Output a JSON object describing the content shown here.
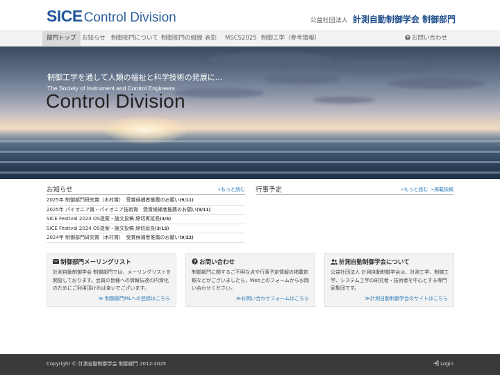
{
  "header": {
    "logo_bold": "SICE",
    "logo_rest": "Control Division",
    "org_sub": "公益社団法人",
    "org_main": "計測自動制御学会 制御部門"
  },
  "nav": {
    "items": [
      "部門トップ",
      "お知らせ",
      "制御部門について",
      "制御部門の組織",
      "表彰",
      "MSCS2025",
      "制御工学（参考情報）"
    ],
    "contact_icon": "question-circle-icon",
    "contact": "お問い合わせ"
  },
  "hero": {
    "tagline": "制御工学を通して人類の福祉と科学技術の発展に…",
    "society": "The Society of Instrument and Control Engineers",
    "title": "Control Division"
  },
  "news": {
    "title": "お知らせ",
    "more": "»もっと読む",
    "items": [
      {
        "text": "2025年 制御部門研究賞（木村賞）　受賞候補者推薦のお願い",
        "date": "(9/11)"
      },
      {
        "text": "2025年 パイオニア賞・パイオニア技術賞　受賞候補者推薦のお願い",
        "date": "(9/11)"
      },
      {
        "text": "SICE Festival 2024 OS提案・論文投稿 締切再延長",
        "date": "(4/5)"
      },
      {
        "text": "SICE Festival 2024 OS提案・論文投稿 締切延長",
        "date": "(3/15)"
      },
      {
        "text": "2024年 制御部門研究賞（木村賞）　受賞候補者推薦のお願い",
        "date": "(9/22)"
      }
    ]
  },
  "events": {
    "title": "行事予定",
    "more": "»もっと読む",
    "request": "»掲載依頼"
  },
  "cards": [
    {
      "icon": "envelope-icon",
      "title": "制御部門メーリングリスト",
      "text": "計測自動制御学会 制御部門では、メーリングリストを開設しております。会員の皆様への情報伝達の円滑化のためにご利用頂ければ幸いでございます。",
      "link": "≫ 制御部門MLへの登録はこちら"
    },
    {
      "icon": "question-circle-icon",
      "title": "お問い合わせ",
      "text": "制御部門に関するご不明な点や行事予定情報の掲載依頼などがございましたら，Web上のフォームからお問い合わせください。",
      "link": "≫お問い合わせフォームはこちら"
    },
    {
      "icon": "users-icon",
      "title": "計測自動制御学会について",
      "text": "公益社団法人 計測自動制御学会は、計測工学、制御工学、システム工学の研究者・技術者を中心とする専門家集団です。",
      "link": "≫計測自動制御学会のサイトはこちら"
    }
  ],
  "footer": {
    "copyright": "Copyright © 計測自動制御学会 制御部門 2012-2025",
    "login_icon": "sign-in-icon",
    "login": "Login"
  },
  "colors": {
    "brand": "#1f5799",
    "link": "#2a7ab8",
    "footer_bg": "#3a3a3a",
    "nav_bg": "#f2f2f2",
    "card_bg": "#f3f3f3"
  }
}
